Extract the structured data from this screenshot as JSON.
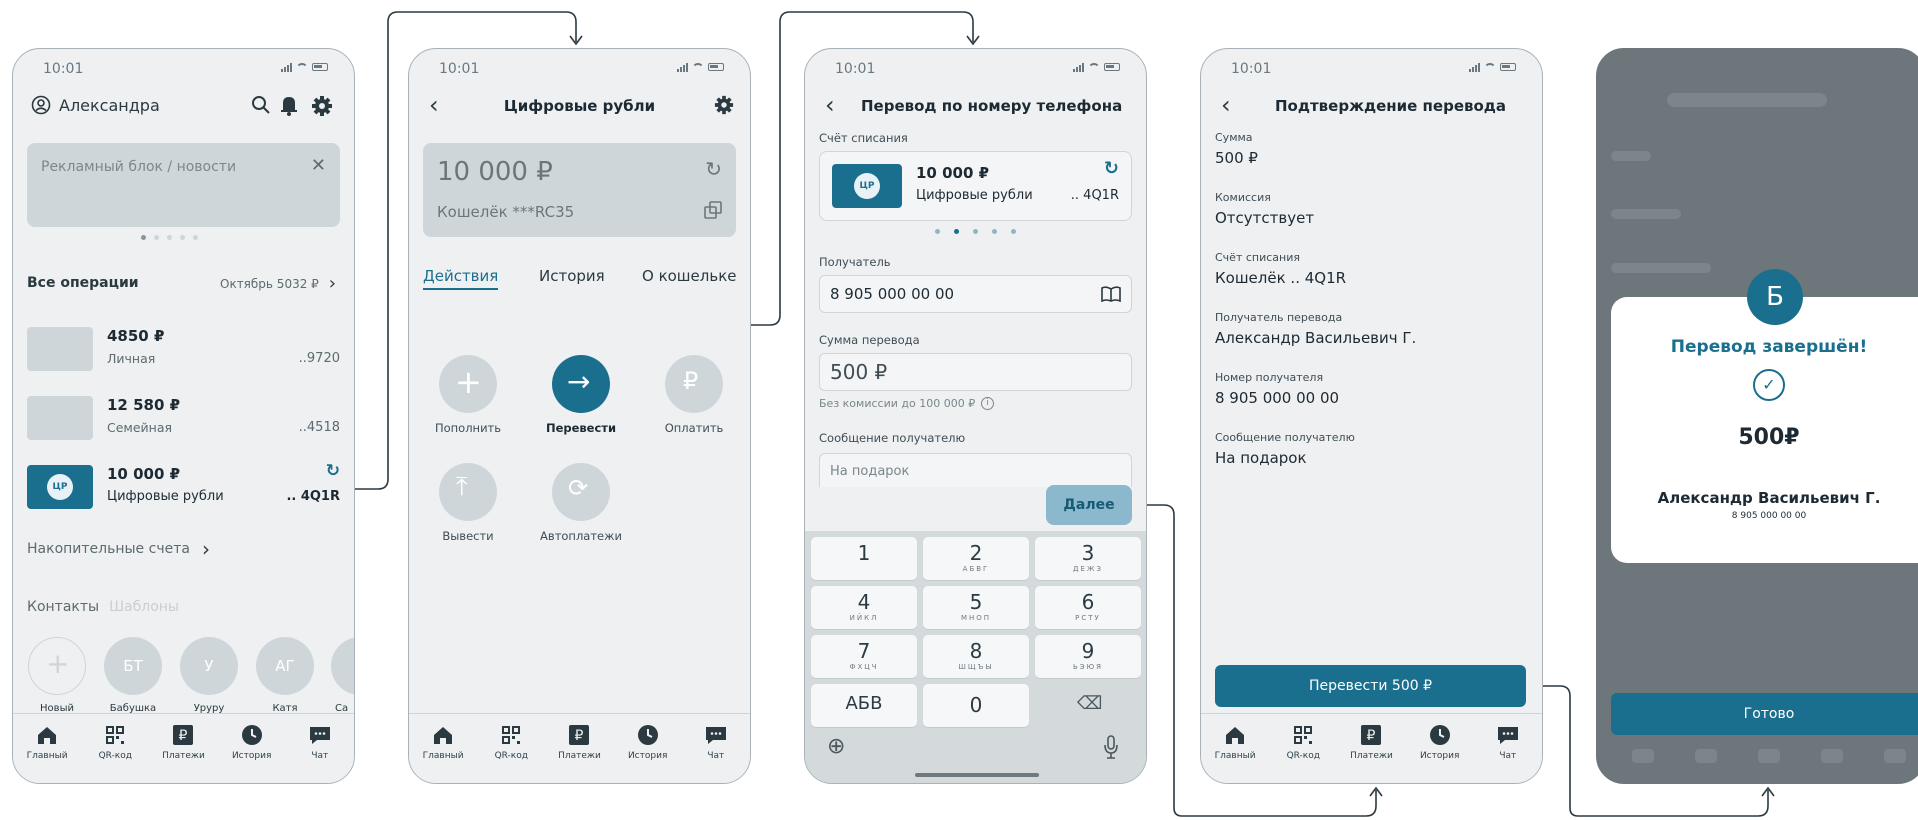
{
  "status": {
    "time": "10:01"
  },
  "screen1": {
    "user_name": "Александра",
    "ad_text": "Рекламный блок / новости",
    "ops_title": "Все операции",
    "ops_summary": "Октябрь 5032 ₽",
    "accounts": [
      {
        "amount": "4850 ₽",
        "name": "Личная",
        "tail": "..9720"
      },
      {
        "amount": "12 580 ₽",
        "name": "Семейная",
        "tail": "..4518"
      },
      {
        "amount": "10 000 ₽",
        "name": "Цифровые рубли",
        "tail": ".. 4Q1R",
        "badge": "ЦР"
      }
    ],
    "savings": "Накопительные счета",
    "contacts_tab": "Контакты",
    "templates_tab": "Шаблоны",
    "contacts": [
      {
        "initials": "",
        "name": "Новый перевод"
      },
      {
        "initials": "БТ",
        "name": "Бабушка Таня"
      },
      {
        "initials": "У",
        "name": "Уруру"
      },
      {
        "initials": "АГ",
        "name": "Катя Новгород"
      },
      {
        "initials": "",
        "name": "Са"
      }
    ]
  },
  "tabs": [
    {
      "label": "Главный",
      "icon": "home-icon"
    },
    {
      "label": "QR-код",
      "icon": "qr-icon"
    },
    {
      "label": "Платежи",
      "icon": "ruble-icon"
    },
    {
      "label": "История",
      "icon": "clock-icon"
    },
    {
      "label": "Чат",
      "icon": "chat-icon"
    }
  ],
  "screen2": {
    "title": "Цифровые рубли",
    "balance": "10 000 ₽",
    "wallet": "Кошелёк  ***RC35",
    "tabs": [
      "Действия",
      "История",
      "О кошельке"
    ],
    "actions": [
      "Пополнить",
      "Перевести",
      "Оплатить",
      "Вывести",
      "Автоплатежи"
    ]
  },
  "screen3": {
    "title": "Перевод по номеру телефона",
    "debit_label": "Счёт списания",
    "card_amount": "10 000 ₽",
    "card_name": "Цифровые рубли",
    "card_tail": ".. 4Q1R",
    "badge": "ЦР",
    "recipient_label": "Получатель",
    "recipient_value": "8 905 000 00 00",
    "amount_label": "Сумма перевода",
    "amount_value": "500 ₽",
    "commission_note": "Без комиссии до 100 000 ₽",
    "message_label": "Сообщение получателю",
    "message_placeholder": "На подарок",
    "next_button": "Далее",
    "keys": [
      {
        "n": "1",
        "l": ""
      },
      {
        "n": "2",
        "l": "АБВГ"
      },
      {
        "n": "3",
        "l": "ДЕЖЗ"
      },
      {
        "n": "4",
        "l": "ИЙКЛ"
      },
      {
        "n": "5",
        "l": "МНОП"
      },
      {
        "n": "6",
        "l": "РСТУ"
      },
      {
        "n": "7",
        "l": "ФХЦЧ"
      },
      {
        "n": "8",
        "l": "ШЩЪЫ"
      },
      {
        "n": "9",
        "l": "ЬЭЮЯ"
      },
      {
        "n": "АБВ",
        "l": ""
      },
      {
        "n": "0",
        "l": ""
      }
    ]
  },
  "screen4": {
    "title": "Подтверждение перевода",
    "fields": [
      {
        "label": "Сумма",
        "value": "500 ₽"
      },
      {
        "label": "Комиссия",
        "value": "Отсутствует"
      },
      {
        "label": "Счёт списания",
        "value": "Кошелёк .. 4Q1R"
      },
      {
        "label": "Получатель перевода",
        "value": "Александр Васильевич Г."
      },
      {
        "label": "Номер получателя",
        "value": "8 905 000 00 00"
      },
      {
        "label": "Сообщение получателю",
        "value": "На подарок"
      }
    ],
    "confirm_button": "Перевести 500 ₽"
  },
  "screen5": {
    "badge": "Б",
    "title": "Перевод завершён!",
    "amount": "500₽",
    "recipient": "Александр Васильевич Г.",
    "phone": "8 905 000 00 00",
    "done_button": "Готово"
  },
  "colors": {
    "accent": "#1b6f8e",
    "placeholder": "#cfd6da",
    "phone_bg": "#eef0f1",
    "overlay": "#6c767b"
  }
}
